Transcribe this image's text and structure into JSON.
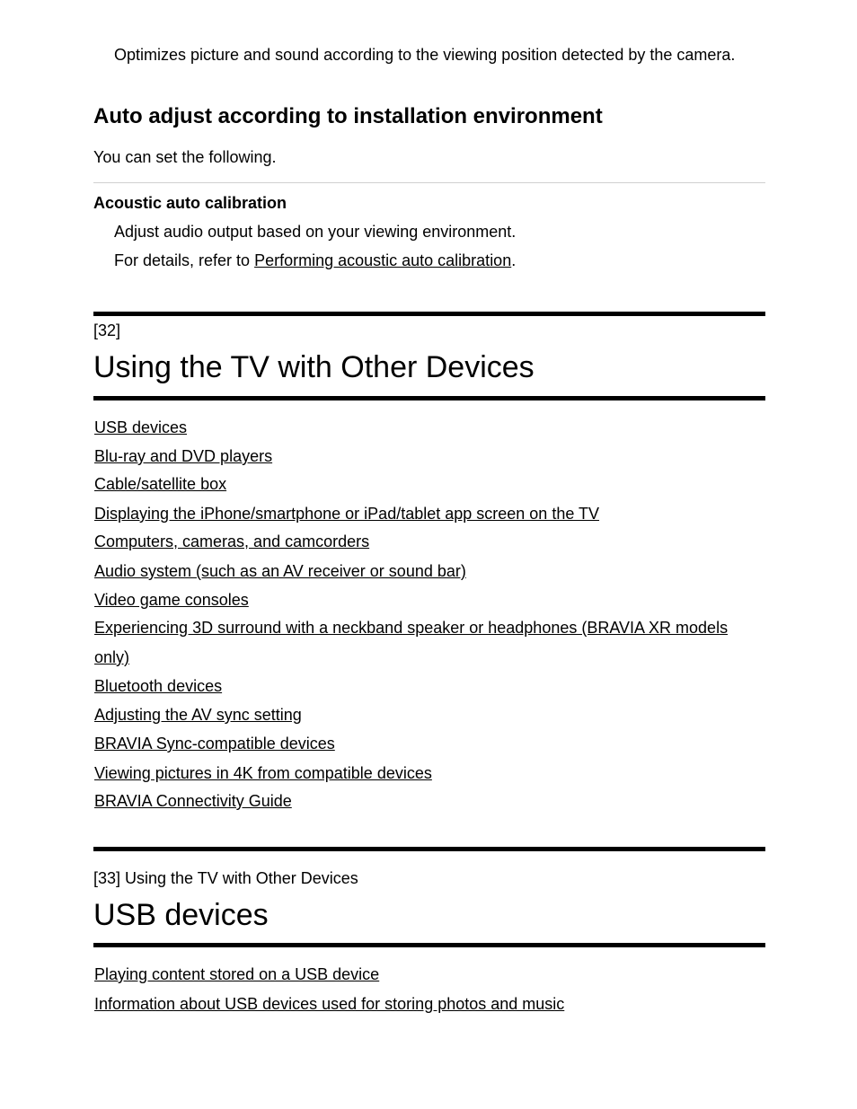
{
  "intro_text": "Optimizes picture and sound according to the viewing position detected by the camera.",
  "auto_adjust": {
    "heading": "Auto adjust according to installation environment",
    "intro": "You can set the following.",
    "item_title": "Acoustic auto calibration",
    "item_desc": "Adjust audio output based on your viewing environment.",
    "details_prefix": "For details, refer to ",
    "details_link": "Performing acoustic auto calibration",
    "details_suffix": "."
  },
  "section_32": {
    "number": "[32]",
    "title": "Using the TV with Other Devices",
    "links": [
      "USB devices",
      "Blu-ray and DVD players",
      "Cable/satellite box",
      "Displaying the iPhone/smartphone or iPad/tablet app screen on the TV",
      "Computers, cameras, and camcorders",
      "Audio system (such as an AV receiver or sound bar)",
      "Video game consoles",
      "Experiencing 3D surround with a neckband speaker or headphones (BRAVIA XR models",
      "only)",
      "Bluetooth devices",
      "Adjusting the AV sync setting",
      "BRAVIA Sync-compatible devices",
      "Viewing pictures in 4K from compatible devices",
      "BRAVIA Connectivity Guide"
    ]
  },
  "section_33": {
    "breadcrumb": "[33] Using the TV with Other Devices",
    "title": "USB devices",
    "links": [
      "Playing content stored on a USB device",
      "Information about USB devices used for storing photos and music"
    ]
  }
}
